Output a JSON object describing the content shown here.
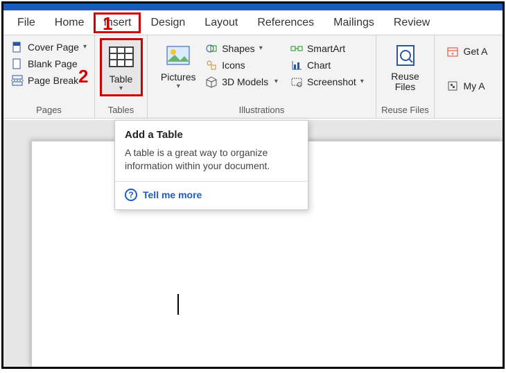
{
  "tabs": {
    "file": "File",
    "home": "Home",
    "insert": "Insert",
    "design": "Design",
    "layout": "Layout",
    "references": "References",
    "mailings": "Mailings",
    "review": "Review"
  },
  "annotations": {
    "one": "1",
    "two": "2"
  },
  "pages_group": {
    "label": "Pages",
    "cover_page": "Cover Page",
    "blank_page": "Blank Page",
    "page_break": "Page Break"
  },
  "tables_group": {
    "label": "Tables",
    "table": "Table"
  },
  "illustrations_group": {
    "label": "Illustrations",
    "pictures": "Pictures",
    "shapes": "Shapes",
    "icons": "Icons",
    "models": "3D Models",
    "smartart": "SmartArt",
    "chart": "Chart",
    "screenshot": "Screenshot"
  },
  "reuse_group": {
    "label": "Reuse Files",
    "reuse": "Reuse\nFiles"
  },
  "addins_group": {
    "get": "Get A",
    "my": "My A"
  },
  "tooltip": {
    "title": "Add a Table",
    "body": "A table is a great way to organize information within your document.",
    "link": "Tell me more"
  }
}
